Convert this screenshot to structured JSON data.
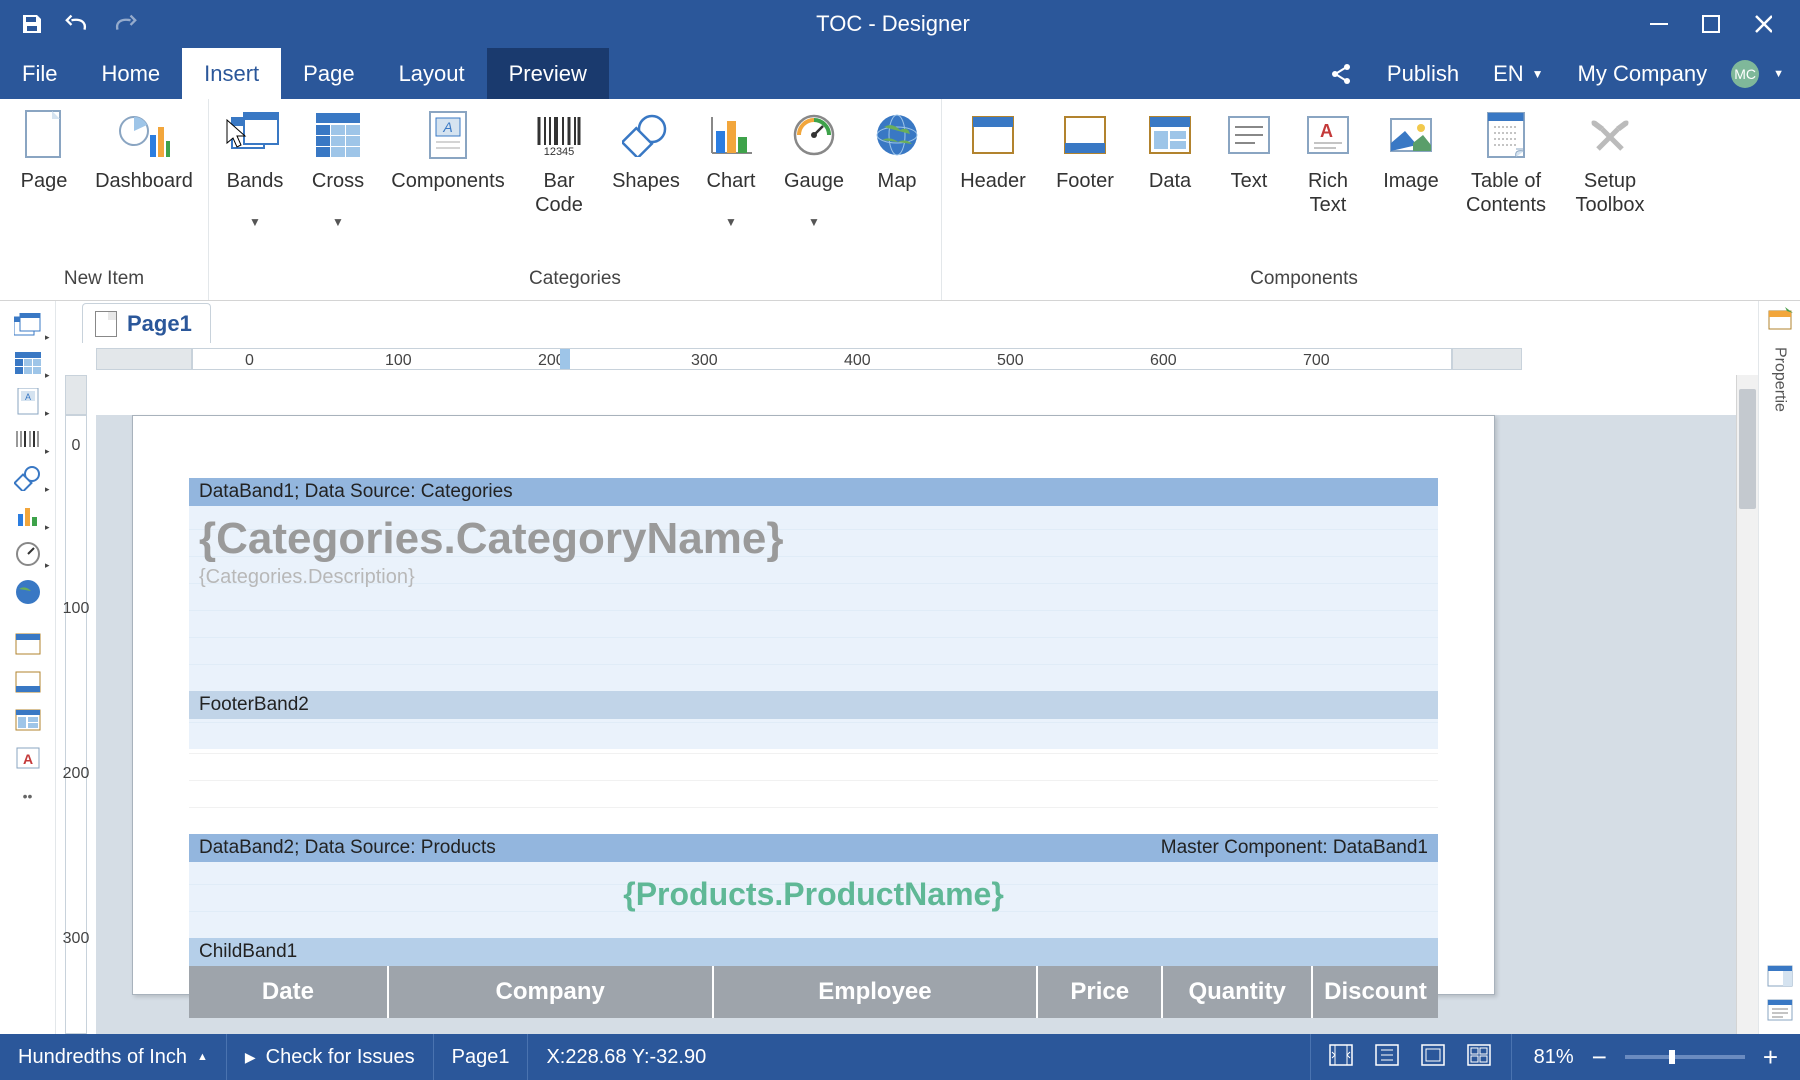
{
  "titlebar": {
    "title": "TOC - Designer"
  },
  "menubar": {
    "tabs": [
      "File",
      "Home",
      "Insert",
      "Page",
      "Layout",
      "Preview"
    ],
    "active": "Insert",
    "publish": "Publish",
    "lang": "EN",
    "company": "My  Company",
    "avatar": "MC"
  },
  "ribbon": {
    "groups": [
      {
        "label": "New Item",
        "items": [
          {
            "name": "page",
            "label": "Page",
            "icon": "page"
          },
          {
            "name": "dashboard",
            "label": "Dashboard",
            "icon": "dashboard"
          }
        ]
      },
      {
        "label": "Categories",
        "items": [
          {
            "name": "bands",
            "label": "Bands",
            "icon": "bands",
            "drop": true
          },
          {
            "name": "cross",
            "label": "Cross",
            "icon": "cross",
            "drop": true
          },
          {
            "name": "components",
            "label": "Components",
            "icon": "components"
          },
          {
            "name": "barcode",
            "label": "Bar Code",
            "icon": "barcode"
          },
          {
            "name": "shapes",
            "label": "Shapes",
            "icon": "shapes"
          },
          {
            "name": "chart",
            "label": "Chart",
            "icon": "chart",
            "drop": true
          },
          {
            "name": "gauge",
            "label": "Gauge",
            "icon": "gauge",
            "drop": true
          },
          {
            "name": "map",
            "label": "Map",
            "icon": "map"
          }
        ]
      },
      {
        "label": "Components",
        "items": [
          {
            "name": "header",
            "label": "Header",
            "icon": "header"
          },
          {
            "name": "footer",
            "label": "Footer",
            "icon": "footer"
          },
          {
            "name": "data",
            "label": "Data",
            "icon": "data"
          },
          {
            "name": "text",
            "label": "Text",
            "icon": "text"
          },
          {
            "name": "richtext",
            "label": "Rich Text",
            "icon": "richtext"
          },
          {
            "name": "image",
            "label": "Image",
            "icon": "image"
          },
          {
            "name": "toc",
            "label": "Table of Contents",
            "icon": "toc"
          },
          {
            "name": "setup",
            "label": "Setup Toolbox",
            "icon": "setup"
          }
        ]
      }
    ]
  },
  "page_tab": "Page1",
  "ruler": {
    "ticks": [
      0,
      100,
      200,
      300,
      400,
      500,
      600,
      700
    ],
    "vticks": [
      0,
      100,
      200,
      300
    ]
  },
  "bands": {
    "databand1": {
      "header": "DataBand1; Data Source: Categories",
      "field1": "{Categories.CategoryName}",
      "field2": "{Categories.Description}"
    },
    "footerband2": {
      "header": "FooterBand2"
    },
    "databand2": {
      "header": "DataBand2; Data Source: Products",
      "master": "Master Component: DataBand1",
      "field1": "{Products.ProductName}"
    },
    "childband1": {
      "header": "ChildBand1",
      "columns": [
        "Date",
        "Company",
        "Employee",
        "Price",
        "Quantity",
        "Discount"
      ]
    }
  },
  "right_panel": {
    "label": "Propertie"
  },
  "statusbar": {
    "units": "Hundredths of Inch",
    "check": "Check for Issues",
    "page": "Page1",
    "coords": "X:228.68 Y:-32.90",
    "zoom": "81%"
  }
}
